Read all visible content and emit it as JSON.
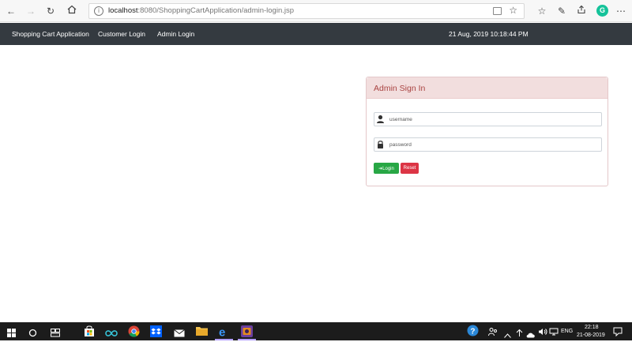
{
  "browser": {
    "url_host": "localhost",
    "url_path": ":8080/ShoppingCartApplication/admin-login.jsp"
  },
  "navbar": {
    "brand": "Shopping Cart Application",
    "links": [
      "Customer Login",
      "Admin Login"
    ],
    "datetime": "21 Aug, 2019 10:18:44 PM"
  },
  "login": {
    "title": "Admin Sign In",
    "username_placeholder": "username",
    "password_placeholder": "password",
    "login_label": "Login",
    "reset_label": "Reset"
  },
  "taskbar": {
    "language": "ENG",
    "time": "22:18",
    "date": "21-08-2019"
  },
  "colors": {
    "navbar_bg": "#343a40",
    "card_header_bg": "#f2dede",
    "card_title": "#a94442",
    "login_button": "#28a745",
    "reset_button": "#dc3545"
  }
}
